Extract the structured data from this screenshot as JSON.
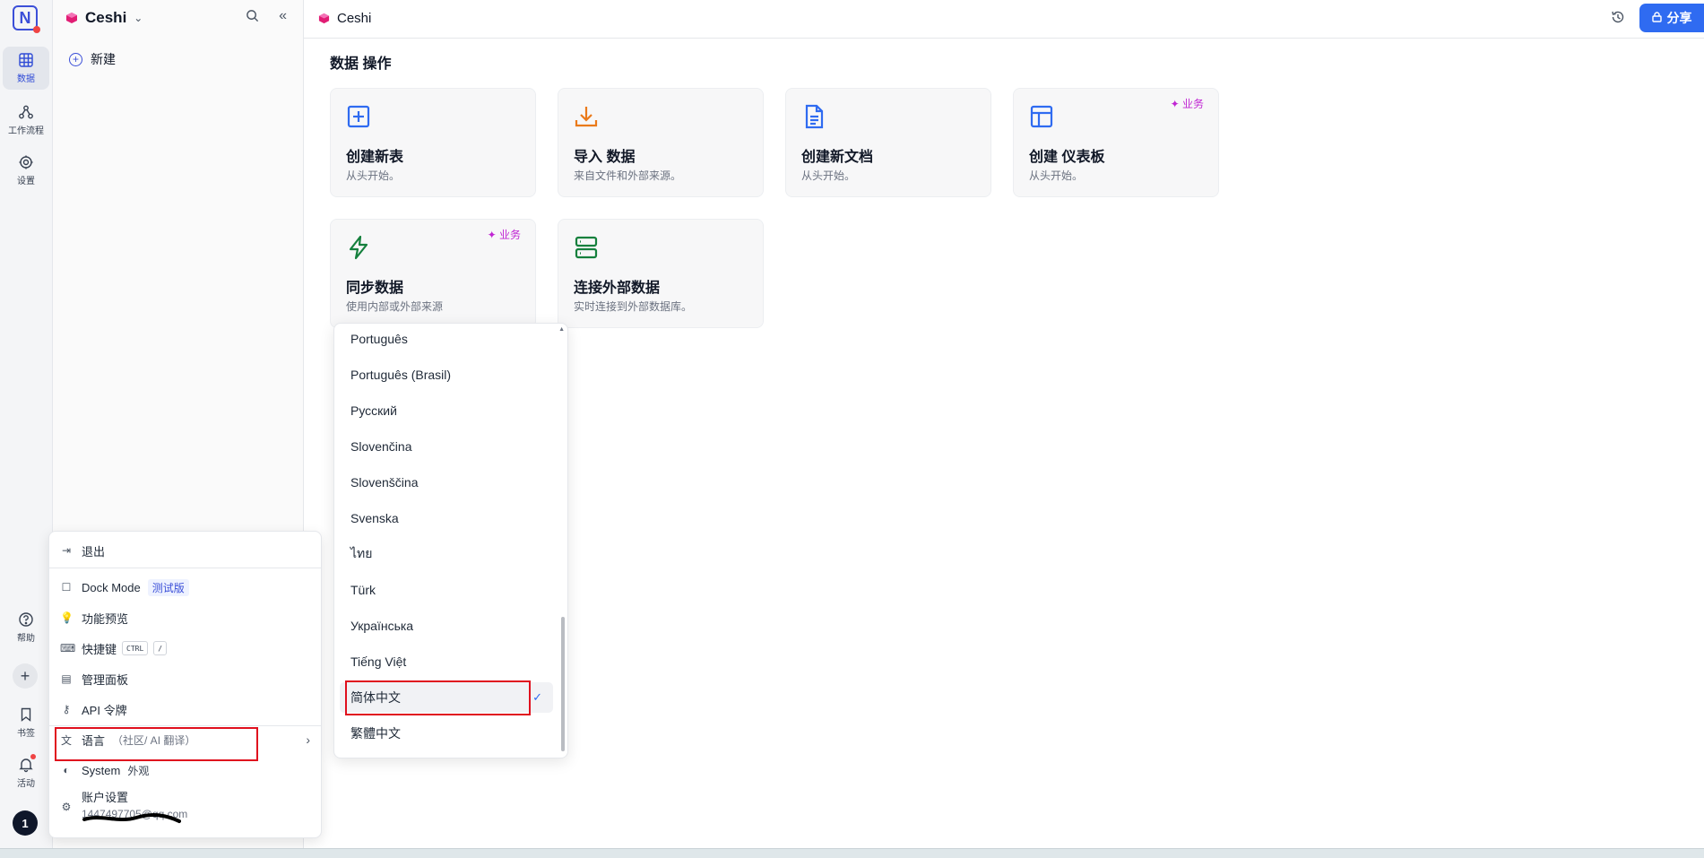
{
  "rail": {
    "items": [
      {
        "label": "数据"
      },
      {
        "label": "工作流程"
      },
      {
        "label": "设置"
      }
    ],
    "help": "帮助",
    "bookmarks": "书签",
    "activity": "活动",
    "avatar_initial": "1"
  },
  "sidebar": {
    "workspace": "Ceshi",
    "new_label": "新建"
  },
  "topbar": {
    "base_title": "Ceshi",
    "share_label": "分享"
  },
  "main": {
    "section_title": "数据 操作",
    "cards": [
      {
        "title": "创建新表",
        "subtitle": "从头开始。",
        "badge": ""
      },
      {
        "title": "导入 数据",
        "subtitle": "来自文件和外部来源。",
        "badge": ""
      },
      {
        "title": "创建新文档",
        "subtitle": "从头开始。",
        "badge": ""
      },
      {
        "title": "创建 仪表板",
        "subtitle": "从头开始。",
        "badge": "✦ 业务"
      },
      {
        "title": "同步数据",
        "subtitle": "使用内部或外部来源",
        "badge": "✦ 业务"
      },
      {
        "title": "连接外部数据",
        "subtitle": "实时连接到外部数据库。",
        "badge": ""
      }
    ]
  },
  "account_menu": {
    "logout": "退出",
    "dock_mode": "Dock Mode",
    "dock_badge": "测试版",
    "feature_preview": "功能预览",
    "shortcuts": "快捷键",
    "shortcut_keys": [
      "CTRL",
      "/"
    ],
    "admin_panel": "管理面板",
    "api_tokens": "API 令牌",
    "language": "语言",
    "language_sub": "（社区/ AI 翻译）",
    "appearance": "System",
    "appearance_sub": "外观",
    "account_settings": "账户设置",
    "account_email": "1447497705@qq.com"
  },
  "language_dropdown": {
    "options": [
      "Português",
      "Português (Brasil)",
      "Русский",
      "Slovenčina",
      "Slovenščina",
      "Svenska",
      "ไทย",
      "Türk",
      "Українська",
      "Tiếng Việt",
      "简体中文",
      "繁體中文"
    ],
    "selected": "简体中文"
  },
  "colors": {
    "accent": "#2f6bf1",
    "highlight_box": "#e0101e",
    "business_badge": "#c026d3"
  }
}
